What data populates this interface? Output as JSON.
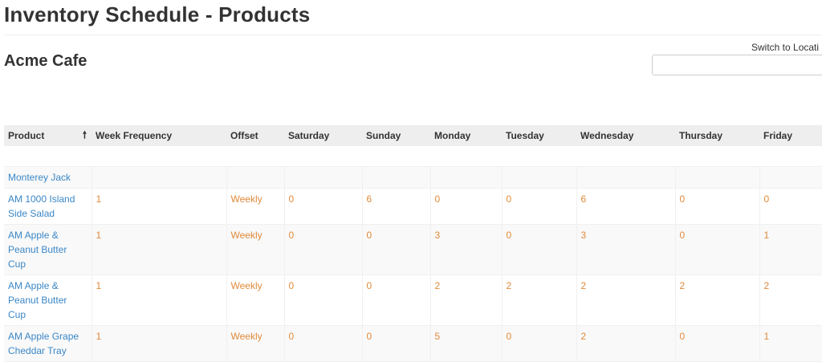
{
  "page": {
    "title": "Inventory Schedule - Products"
  },
  "location": {
    "name": "Acme Cafe",
    "switch_label": "Switch to Locati"
  },
  "table": {
    "columns": [
      "Product",
      "Week Frequency",
      "Offset",
      "Saturday",
      "Sunday",
      "Monday",
      "Tuesday",
      "Wednesday",
      "Thursday",
      "Friday"
    ],
    "sort_column": "Product",
    "sort_direction": "ascending",
    "rows": [
      {
        "product": "Monterey Jack",
        "frequency": "",
        "offset": "",
        "saturday": "",
        "sunday": "",
        "monday": "",
        "tuesday": "",
        "wednesday": "",
        "thursday": "",
        "friday": ""
      },
      {
        "product": "AM 1000 Island Side Salad",
        "frequency": "1",
        "offset": "Weekly",
        "saturday": "0",
        "sunday": "6",
        "monday": "0",
        "tuesday": "0",
        "wednesday": "6",
        "thursday": "0",
        "friday": "0"
      },
      {
        "product": "AM Apple & Peanut Butter Cup",
        "frequency": "1",
        "offset": "Weekly",
        "saturday": "0",
        "sunday": "0",
        "monday": "3",
        "tuesday": "0",
        "wednesday": "3",
        "thursday": "0",
        "friday": "1"
      },
      {
        "product": "AM Apple & Peanut Butter Cup",
        "frequency": "1",
        "offset": "Weekly",
        "saturday": "0",
        "sunday": "0",
        "monday": "2",
        "tuesday": "2",
        "wednesday": "2",
        "thursday": "2",
        "friday": "2"
      },
      {
        "product": "AM Apple Grape Cheddar Tray",
        "frequency": "1",
        "offset": "Weekly",
        "saturday": "0",
        "sunday": "0",
        "monday": "5",
        "tuesday": "0",
        "wednesday": "2",
        "thursday": "0",
        "friday": "1"
      }
    ]
  },
  "colors": {
    "link": "#3b87c6",
    "value": "#e08a3a",
    "header_bg": "#eeeeee"
  }
}
